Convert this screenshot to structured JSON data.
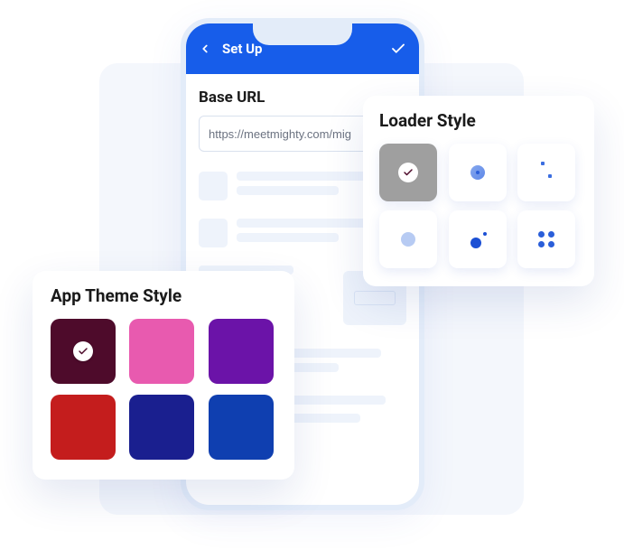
{
  "phone": {
    "topbar": {
      "title": "Set Up"
    },
    "form": {
      "url_label": "Base URL",
      "url_value": "https://meetmighty.com/mig"
    }
  },
  "loader_card": {
    "title": "Loader Style",
    "items": [
      {
        "id": "loader-bounce",
        "selected": true
      },
      {
        "id": "loader-pulse",
        "selected": false
      },
      {
        "id": "loader-dots-corner",
        "selected": false
      },
      {
        "id": "loader-fade",
        "selected": false
      },
      {
        "id": "loader-orbit",
        "selected": false
      },
      {
        "id": "loader-grid",
        "selected": false
      }
    ]
  },
  "theme_card": {
    "title": "App Theme Style",
    "swatches": [
      {
        "color": "#4e0b2b",
        "selected": true
      },
      {
        "color": "#e85aaf",
        "selected": false
      },
      {
        "color": "#6b13a8",
        "selected": false
      },
      {
        "color": "#c41d1d",
        "selected": false
      },
      {
        "color": "#1a1f8f",
        "selected": false
      },
      {
        "color": "#0f3fb0",
        "selected": false
      }
    ]
  },
  "colors": {
    "accent": "#175dea",
    "check": "#4e0b2b"
  }
}
